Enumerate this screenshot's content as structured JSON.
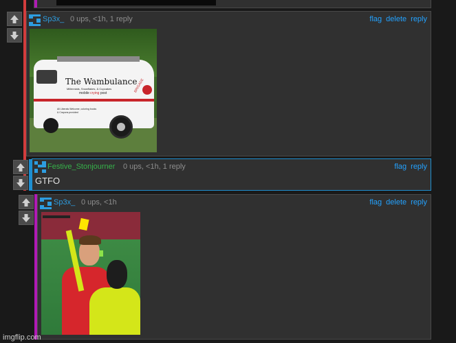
{
  "top_stub": {
    "text": "..."
  },
  "comments": [
    {
      "username": "Sp3x_",
      "meta": "0 ups, <1h, 1 reply",
      "actions": [
        "flag",
        "delete",
        "reply"
      ],
      "image": {
        "van_title": "The Wambulance",
        "van_sub1": "Millennials, Snowflakes, & Cupcakes",
        "van_sub2_a": "mobile ",
        "van_sub2_b": "crying",
        "van_sub2_c": " post",
        "van_small": "All Liberals Welcome, coloring books & Crayons provided",
        "van_side": "BRIGADE"
      }
    },
    {
      "username": "Festive_Stonjourner",
      "meta": "0 ups, <1h, 1 reply",
      "actions": [
        "flag",
        "reply"
      ],
      "text": "GTFO"
    },
    {
      "username": "Sp3x_",
      "meta": "0 ups, <1h",
      "actions": [
        "flag",
        "delete",
        "reply"
      ]
    }
  ],
  "footer": {
    "watermark": "imgflip.com"
  },
  "colors": {
    "accent_link": "#23a2ff",
    "bar_magenta": "#b01ab5",
    "bar_red": "#d23c3c",
    "bar_blue": "#1e8fd1",
    "user_blue": "#2d9de0",
    "user_green": "#36b24a"
  },
  "icons": [
    "upvote-arrow-icon",
    "downvote-arrow-icon",
    "user-avatar-icon"
  ]
}
